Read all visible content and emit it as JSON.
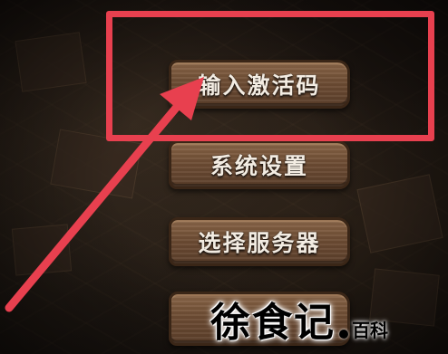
{
  "menu": {
    "items": [
      {
        "label": "输入激活码"
      },
      {
        "label": "系统设置"
      },
      {
        "label": "选择服务器"
      },
      {
        "label": ""
      }
    ]
  },
  "annotation": {
    "highlight_color": "#e8404f",
    "arrow_color": "#e8404f"
  },
  "watermark": {
    "main": "徐食记",
    "sub": "百科"
  },
  "colors": {
    "button_wood": "#6e4d34",
    "button_border": "#3a2617",
    "label_text": "#f3ece2"
  }
}
